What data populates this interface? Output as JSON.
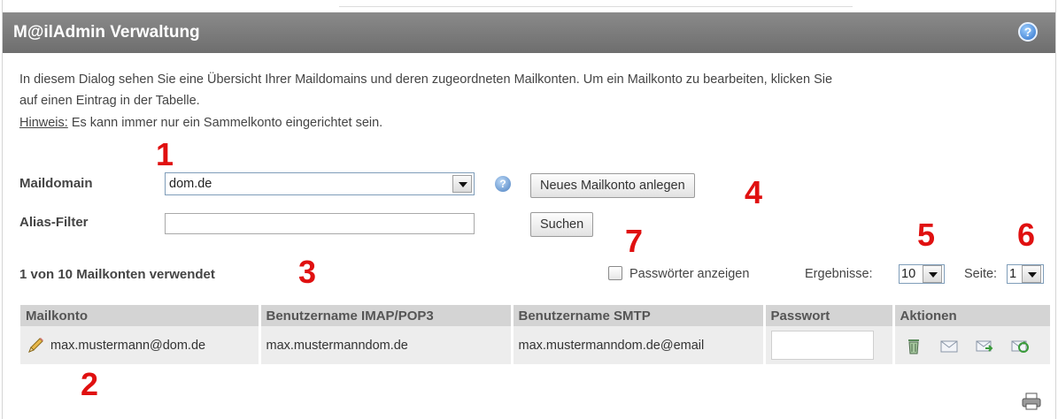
{
  "header": {
    "title": "M@ilAdmin Verwaltung",
    "help_icon": "help-icon"
  },
  "intro": {
    "line1": "In diesem Dialog sehen Sie eine Übersicht Ihrer Maildomains und deren zugeordneten Mailkonten. Um ein Mailkonto zu bearbeiten, klicken Sie",
    "line2": "auf einen Eintrag in der Tabelle.",
    "hint_label": "Hinweis:",
    "hint_text": " Es kann immer nur ein Sammelkonto eingerichtet sein."
  },
  "form": {
    "maildomain_label": "Maildomain",
    "maildomain_value": "dom.de",
    "alias_label": "Alias-Filter",
    "alias_value": "",
    "new_account_button": "Neues Mailkonto anlegen",
    "search_button": "Suchen"
  },
  "status": {
    "used_text": "1 von 10 Mailkonten verwendet",
    "show_passwords_label": "Passwörter anzeigen",
    "show_passwords_checked": false,
    "results_label": "Ergebnisse:",
    "results_value": "10",
    "page_label": "Seite:",
    "page_value": "1"
  },
  "table": {
    "columns": [
      "Mailkonto",
      "Benutzername IMAP/POP3",
      "Benutzername SMTP",
      "Passwort",
      "Aktionen"
    ],
    "rows": [
      {
        "account": "max.mustermann@dom.de",
        "imap_user": "max.mustermanndom.de",
        "smtp_user": "max.mustermanndom.de@email",
        "password": ""
      }
    ],
    "action_icons": [
      "trash-icon",
      "mail-icon",
      "mail-forward-icon",
      "mail-refresh-icon"
    ]
  },
  "annotations": [
    "1",
    "2",
    "3",
    "4",
    "5",
    "6",
    "7"
  ],
  "colors": {
    "titlebar": "#7a7a7a",
    "annotation": "#e01010",
    "header_cell": "#d4d4d4",
    "row_cell": "#ededed"
  }
}
